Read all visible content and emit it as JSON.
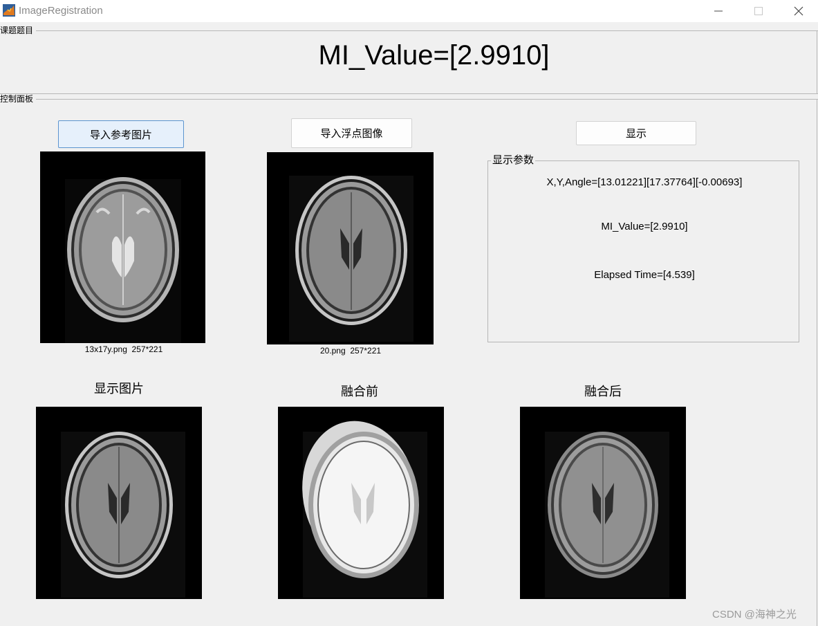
{
  "window": {
    "title": "ImageRegistration",
    "app_icon": "matlab-icon",
    "controls": [
      "minimize-icon",
      "maximize-icon",
      "close-icon"
    ]
  },
  "title_panel": {
    "label": "课题题目",
    "heading": "MI_Value=[2.9910]"
  },
  "control_panel": {
    "label": "控制面板",
    "buttons": {
      "import_reference": "导入参考图片",
      "import_floating": "导入浮点图像",
      "show": "显示"
    },
    "reference_caption": "13x17y.png  257*221",
    "floating_caption": "20.png  257*221"
  },
  "display_params": {
    "label": "显示参数",
    "xy_angle": "X,Y,Angle=[13.01221][17.37764][-0.00693]",
    "mi_value": "MI_Value=[2.9910]",
    "elapsed": "Elapsed Time=[4.539]"
  },
  "results": {
    "display_title": "显示图片",
    "before_title": "融合前",
    "after_title": "融合后"
  },
  "watermark": "CSDN @海神之光",
  "colors": {
    "background": "#f0f0f0",
    "active_button_border": "#5b94cf",
    "active_button_fill": "#e6f0fb"
  }
}
